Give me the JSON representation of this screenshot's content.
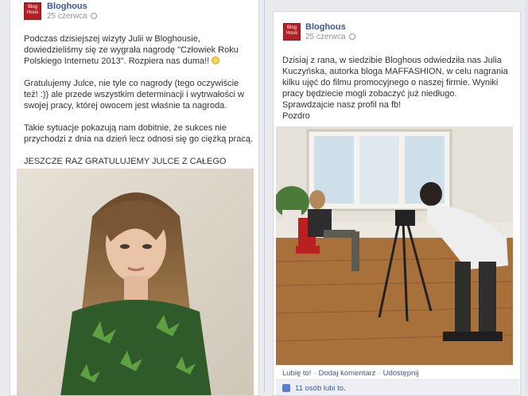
{
  "left_post": {
    "page_name": "Bloghous",
    "date": "25 czerwca",
    "logo_lines": [
      "Blog",
      "Hous"
    ],
    "paragraphs": [
      "Podczas dzisiejszej wizyty Julii w Bloghousie, dowiedzieliśmy się ze wygrała nagrodę \"Człowiek Roku Polskiego Internetu 2013\". Rozpiera nas duma!!",
      "Gratulujemy Julce, nie tyle co nagrody (tego oczywiście też! :)) ale przede wszystkim determinacji i wytrwałości w swojej pracy, której owocem jest właśnie ta nagroda.",
      "Takie sytuacje pokazują nam dobitnie, że sukces nie przychodzi z dnia na dzień lecz odnosi się go ciężką pracą.",
      "JESZCZE RAZ GRATULUJEMY JULCE Z CAŁEGO SERCA!!"
    ]
  },
  "right_post": {
    "page_name": "Bloghous",
    "date": "25 czerwca",
    "logo_lines": [
      "Blog",
      "Hous"
    ],
    "lines": [
      "Dzisiaj z rana, w siedzibie Bloghous odwiedziła nas Julia Kuczyńska, autorka bloga MAFFASHION, w celu nagrania kilku ujęć do filmu promocyjnego o naszej firmie. Wyniki pracy będziecie mogli zobaczyć już niedługo.",
      "Sprawdzajcie nasz profil na fb!",
      "Pozdro"
    ],
    "actions": {
      "like": "Lubię to!",
      "comment": "Dodaj komentarz",
      "share": "Udostępnij"
    },
    "likes_text": "11 osób lubi to."
  },
  "colors": {
    "brand_red": "#b21f24",
    "link_blue": "#3b5998"
  }
}
